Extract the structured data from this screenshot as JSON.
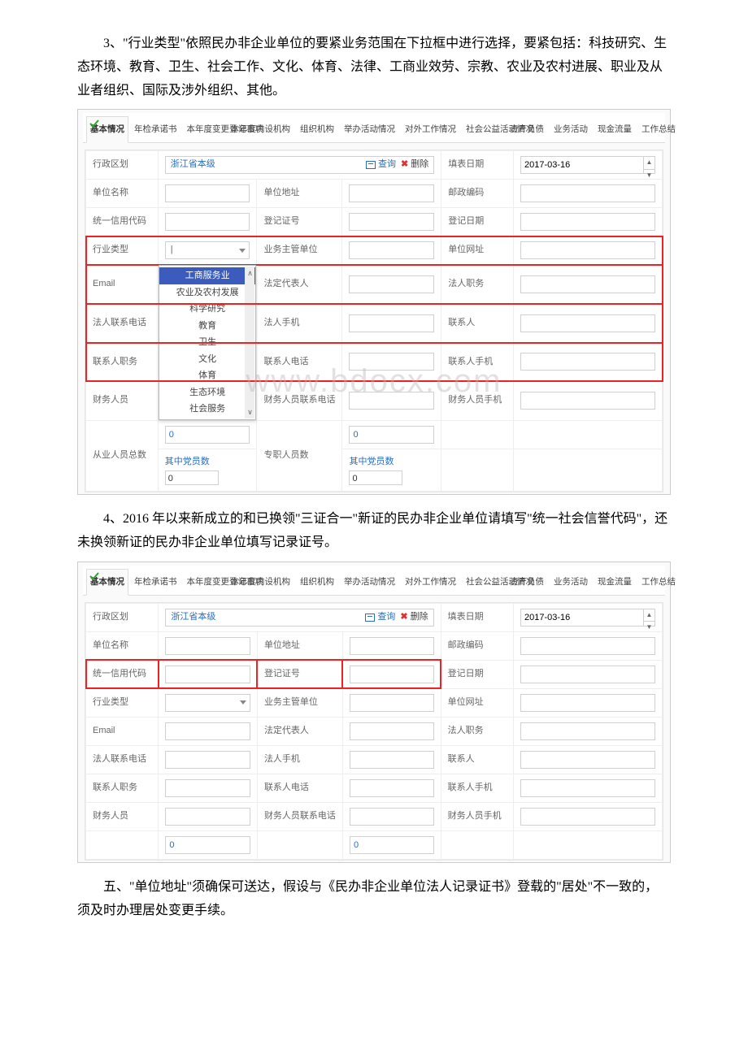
{
  "paragraphs": {
    "p1": "3、\"行业类型\"依照民办非企业单位的要紧业务范围在下拉框中进行选择，要紧包括：科技研究、生态环境、教育、卫生、社会工作、文化、体育、法律、工商业效劳、宗教、农业及农村进展、职业及从业者组织、国际及涉外组织、其他。",
    "p2": "4、2016 年以来新成立的和已换领\"三证合一\"新证的民办非企业单位请填写\"统一社会信誉代码\"，还未换领新证的民办非企业单位填写记录证号。",
    "p3": "五、\"单位地址\"须确保可送达，假设与《民办非企业单位法人记录证书》登载的\"居处\"不一致的，须及时办理居处变更手续。"
  },
  "tabs": [
    "基本情况",
    "年检承诺书",
    "本年度变更登记事项",
    "本年度内设机构",
    "组织机构",
    "举办活动情况",
    "对外工作情况",
    "社会公益活动情况",
    "资产负债",
    "业务活动",
    "现金流量",
    "工作总结"
  ],
  "form": {
    "region_label": "行政区划",
    "region_value": "浙江省本级",
    "query": "查询",
    "delete": "删除",
    "fill_date_label": "填表日期",
    "fill_date_value": "2017-03-16",
    "unit_name": "单位名称",
    "unit_addr": "单位地址",
    "post_code": "邮政编码",
    "credit_code": "统一信用代码",
    "reg_no": "登记证号",
    "reg_date": "登记日期",
    "industry": "行业类型",
    "supervisor": "业务主管单位",
    "website": "单位网址",
    "email": "Email",
    "legal_rep": "法定代表人",
    "legal_title": "法人职务",
    "legal_phone": "法人联系电话",
    "legal_mobile": "法人手机",
    "contact": "联系人",
    "contact_title": "联系人职务",
    "contact_phone": "联系人电话",
    "contact_mobile": "联系人手机",
    "finance": "财务人员",
    "finance_phone": "财务人员联系电话",
    "finance_mobile": "财务人员手机",
    "staff_total": "从业人员总数",
    "fulltime": "专职人员数",
    "party_sub": "其中党员数",
    "zero": "0"
  },
  "industry_options": [
    "工商服务业",
    "农业及农村发展",
    "科学研究",
    "教育",
    "卫生",
    "文化",
    "体育",
    "生态环境",
    "社会服务"
  ],
  "watermark": "www.bdocx.com"
}
